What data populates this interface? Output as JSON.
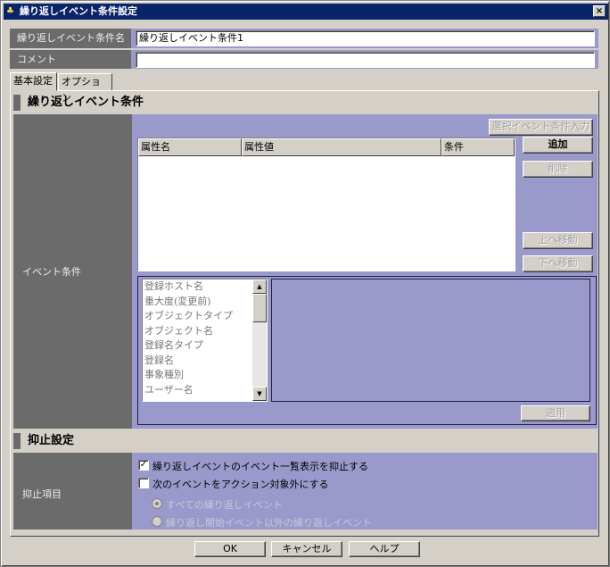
{
  "window": {
    "title": "繰り返しイベント条件設定",
    "close_icon": "close-icon"
  },
  "fields": {
    "name_label": "繰り返しイベント条件名",
    "name_value": "繰り返しイベント条件1",
    "comment_label": "コメント",
    "comment_value": ""
  },
  "tabs": [
    {
      "label": "基本設定",
      "active": true
    },
    {
      "label": "オプション",
      "active": false
    }
  ],
  "event_section": {
    "header": "繰り返しイベント条件",
    "row_label": "イベント条件",
    "select_button": "選択イベント条件入力",
    "table": {
      "columns": [
        "属性名",
        "属性値",
        "条件"
      ],
      "rows": []
    },
    "buttons": {
      "add": "追加",
      "delete": "削除",
      "move_up": "上へ移動",
      "move_down": "下へ移動"
    },
    "attribute_list": [
      "登録ホスト名",
      "重大度(変更前)",
      "オブジェクトタイプ",
      "オブジェクト名",
      "登録名タイプ",
      "登録名",
      "事象種別",
      "ユーザー名"
    ],
    "apply_button": "適用"
  },
  "suppress_section": {
    "header": "抑止設定",
    "row_label": "抑止項目",
    "checkbox1": {
      "label": "繰り返しイベントのイベント一覧表示を抑止する",
      "checked": true
    },
    "checkbox2": {
      "label": "次のイベントをアクション対象外にする",
      "checked": false
    },
    "radio1": {
      "label": "すべての繰り返しイベント",
      "selected": true,
      "enabled": false
    },
    "radio2": {
      "label": "繰り返し開始イベント以外の繰り返しイベント",
      "selected": false,
      "enabled": false
    }
  },
  "footer": {
    "ok": "OK",
    "cancel": "キャンセル",
    "help": "ヘルプ"
  },
  "colors": {
    "titlebar": "#0a246a",
    "panel_purple": "#9999cc",
    "label_gray": "#6b6b6b",
    "dialog_bg": "#d4d0c8"
  }
}
